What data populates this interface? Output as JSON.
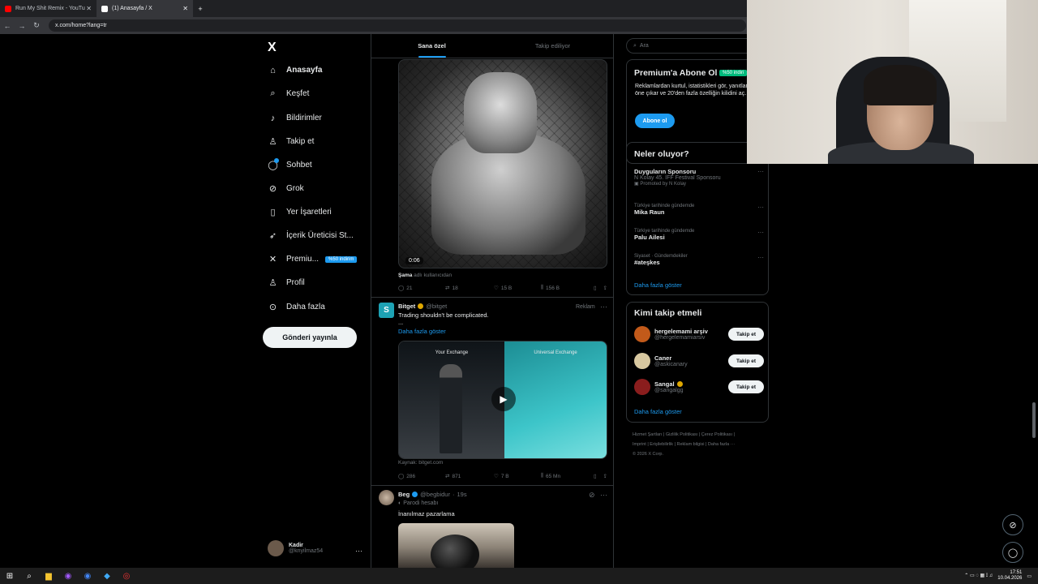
{
  "browser": {
    "tabs": [
      {
        "title": "Run My Shit Remix - YouTu",
        "active": false,
        "favicon_color": "#ff0000"
      },
      {
        "title": "(1) Anasayfa / X",
        "active": true,
        "favicon_color": "#ffffff"
      }
    ],
    "url": "x.com/home?lang=tr"
  },
  "nav": {
    "logo": "X",
    "items": [
      {
        "label": "Anasayfa",
        "icon": "home-icon",
        "glyph": "⌂"
      },
      {
        "label": "Keşfet",
        "icon": "search-icon",
        "glyph": "⌕"
      },
      {
        "label": "Bildirimler",
        "icon": "bell-icon",
        "glyph": "🔔︎"
      },
      {
        "label": "Takip et",
        "icon": "follow-icon",
        "glyph": "👤︎"
      },
      {
        "label": "Sohbet",
        "icon": "chat-icon",
        "glyph": "💬︎"
      },
      {
        "label": "Grok",
        "icon": "grok-icon",
        "glyph": "⊘"
      },
      {
        "label": "Yer İşaretleri",
        "icon": "bookmark-icon",
        "glyph": "🔖︎"
      },
      {
        "label": "İçerik Üreticisi St...",
        "icon": "rocket-icon",
        "glyph": "🚀︎"
      },
      {
        "label": "Premiu...",
        "icon": "x-premium-icon",
        "glyph": "✕"
      },
      {
        "label": "Profil",
        "icon": "profile-icon",
        "glyph": "👤︎"
      },
      {
        "label": "Daha fazla",
        "icon": "more-circle-icon",
        "glyph": "⊙"
      }
    ],
    "premium_badge": "%50 indirim",
    "post_button": "Gönderi yayınla",
    "account": {
      "name": "Kadir",
      "handle": "@knyilmaz54"
    }
  },
  "feed": {
    "tabs": [
      "Sana özel",
      "Takip ediliyor"
    ],
    "post1": {
      "timecode": "0:06",
      "caption_user": "Şama",
      "caption_rest": "adlı kullanıcıdan",
      "replies": "21",
      "reposts": "18",
      "likes": "15 B",
      "views": "156 B"
    },
    "post2": {
      "name": "Bitget",
      "handle": "@bitget",
      "ad_label": "Reklam",
      "text": "Trading shouldn't be complicated.",
      "ellipsis": "...",
      "show_more": "Daha fazla göster",
      "media_left": "Your Exchange",
      "media_right": "Universal Exchange",
      "source": "Kaynak: bitget.com",
      "replies": "286",
      "reposts": "871",
      "likes": "7 B",
      "views": "65 Mn"
    },
    "post3": {
      "name": "Beg",
      "handle": "@begbidur",
      "time": "19s",
      "parody": "Parodi hesabı",
      "text": "İnanılmaz pazarlama"
    }
  },
  "sidebar": {
    "search_placeholder": "Ara",
    "premium": {
      "title": "Premium'a Abone Ol",
      "badge": "%50 indiri",
      "text": "Reklamlardan kurtul, istatistikleri gör, yanıtlarını öne çıkar ve 20'den fazla özelliğin kilidini aç.",
      "button": "Abone ol"
    },
    "trends": {
      "title": "Neler oluyor?",
      "items": [
        {
          "context": "",
          "title": "Duyguların Sponsoru",
          "subtitle": "N Kolay 45. İFF Festival Sponsoru",
          "promoted": "Promoted by N Kolay"
        },
        {
          "context": "Türkiye tarihinde gündemde",
          "title": "Mika Raun",
          "subtitle": "",
          "promoted": ""
        },
        {
          "context": "Türkiye tarihinde gündemde",
          "title": "Palu Ailesi",
          "subtitle": "",
          "promoted": ""
        },
        {
          "context": "Siyaset · Gündemdekiler",
          "title": "#ateşkes",
          "subtitle": "",
          "promoted": ""
        }
      ],
      "show_more": "Daha fazla göster"
    },
    "who_to_follow": {
      "title": "Kimi takip etmeli",
      "items": [
        {
          "name": "hergelemami arşiv",
          "handle": "@hergelemamiarsiv",
          "button": "Takip et",
          "color": "#c25a1a"
        },
        {
          "name": "Caner",
          "handle": "@askicanary",
          "button": "Takip et",
          "color": "#d8c8a0"
        },
        {
          "name": "Sangal",
          "handle": "@sangalgg",
          "button": "Takip et",
          "color": "#8a1d1d"
        }
      ],
      "show_more": "Daha fazla göster"
    },
    "footer": {
      "line1": "Hizmet Şartları | Gizlilik Politikası | Çerez Politikası |",
      "line2": "Imprint | Erişilebilirlik | Reklam bilgisi | Daha fazla ···",
      "line3": "© 2026 X Corp."
    }
  },
  "taskbar": {
    "time": "17:51",
    "date": "10.04.2026"
  }
}
